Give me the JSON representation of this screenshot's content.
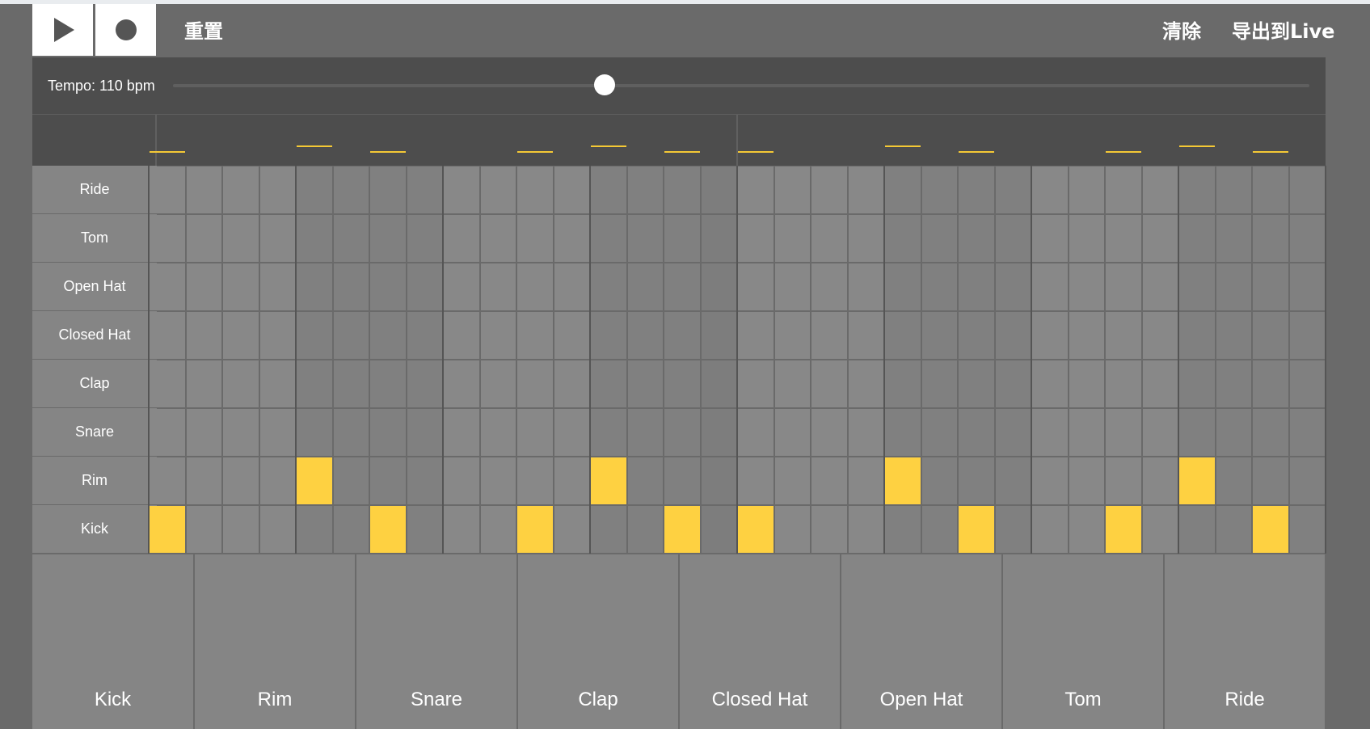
{
  "toolbar": {
    "play_icon": "play-icon",
    "record_icon": "record-icon",
    "reset_label": "重置",
    "clear_label": "清除",
    "export_label": "导出到Live"
  },
  "tempo": {
    "label": "Tempo: 110 bpm",
    "bpm": 110,
    "slider_fraction": 0.38
  },
  "sequencer": {
    "steps": 32,
    "current_step": 15,
    "instruments": [
      "Ride",
      "Tom",
      "Open Hat",
      "Closed Hat",
      "Clap",
      "Snare",
      "Rim",
      "Kick"
    ],
    "pattern": {
      "Ride": [],
      "Tom": [],
      "Open Hat": [],
      "Closed Hat": [],
      "Clap": [],
      "Snare": [],
      "Rim": [
        4,
        12,
        20,
        28
      ],
      "Kick": [
        0,
        6,
        10,
        14,
        16,
        22,
        26,
        30
      ]
    }
  },
  "pads": [
    "Kick",
    "Rim",
    "Snare",
    "Clap",
    "Closed Hat",
    "Open Hat",
    "Tom",
    "Ride"
  ],
  "colors": {
    "active": "#fed141",
    "cell": "#888888",
    "background": "#6a6a6a",
    "panel": "#4d4d4d"
  }
}
